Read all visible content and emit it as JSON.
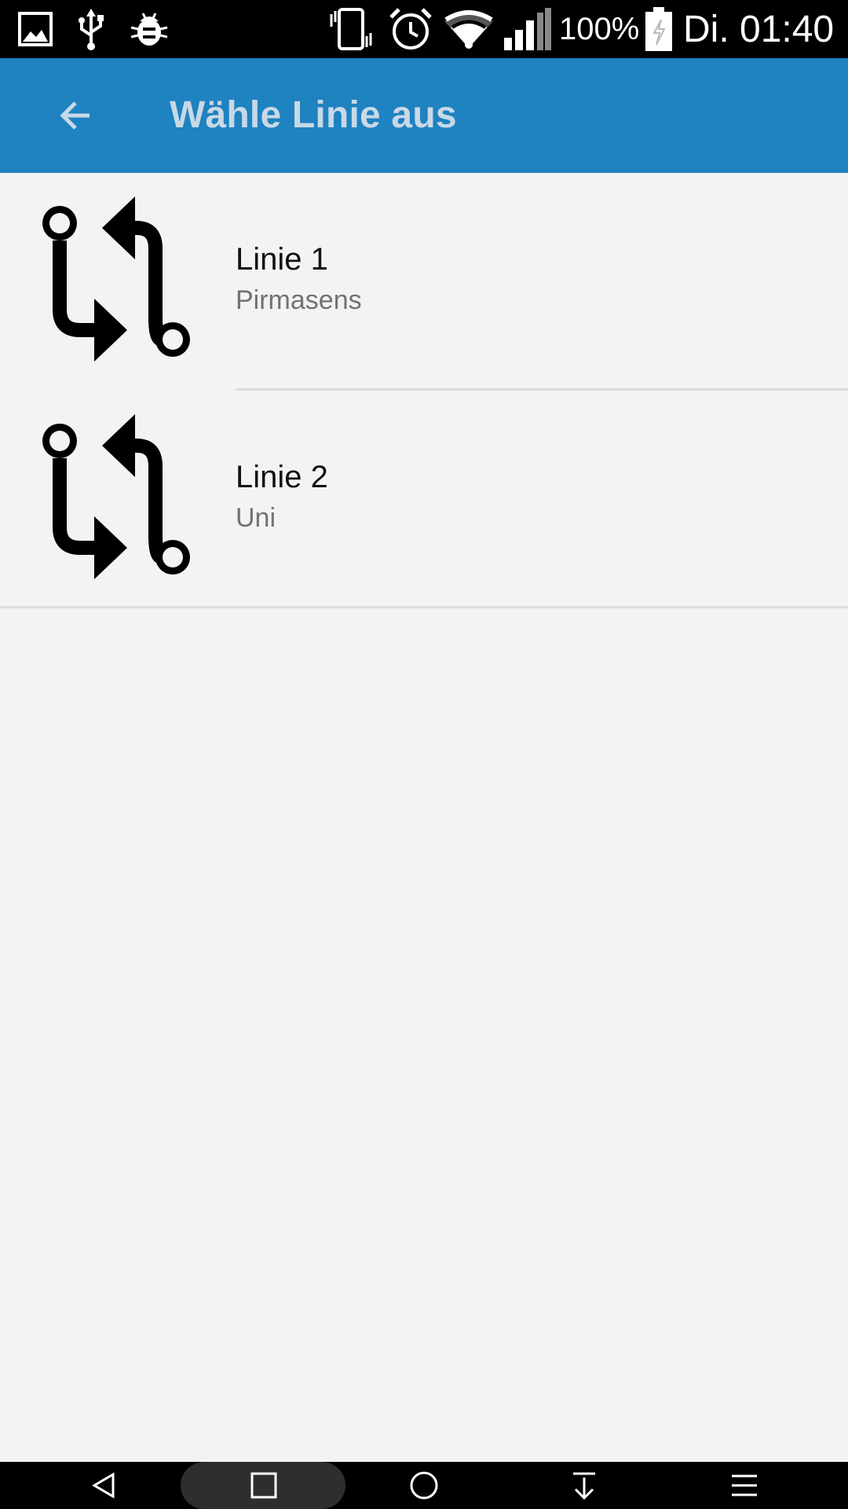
{
  "status_bar": {
    "icons": [
      "image-icon",
      "usb-icon",
      "debug-bug-icon",
      "vibrate-icon",
      "alarm-icon",
      "wifi-icon",
      "signal-icon",
      "battery-icon"
    ],
    "battery_percent": "100%",
    "time": "Di. 01:40"
  },
  "app_bar": {
    "back_icon": "arrow-left-icon",
    "title": "Wähle Linie aus",
    "background_color": "#1f82c1",
    "title_color": "#c8d9e6"
  },
  "lines": [
    {
      "icon": "route-swap-icon",
      "title": "Linie 1",
      "subtitle": "Pirmasens"
    },
    {
      "icon": "route-swap-icon",
      "title": "Linie 2",
      "subtitle": "Uni"
    }
  ],
  "nav_bar": {
    "buttons": [
      "back-triangle-icon",
      "recents-square-icon",
      "home-circle-icon",
      "notification-pull-icon",
      "menu-icon"
    ]
  }
}
